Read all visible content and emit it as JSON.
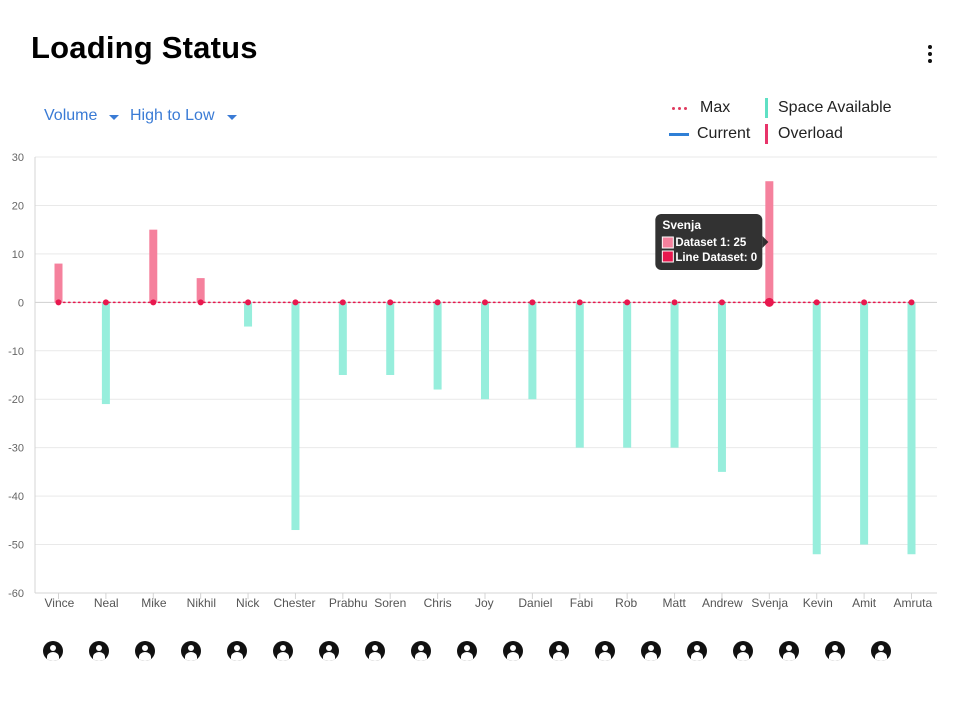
{
  "title": "Loading Status",
  "controls": {
    "volume_label": "Volume",
    "sort_label": "High to Low"
  },
  "legend": {
    "max": "Max",
    "current": "Current",
    "space_available": "Space Available",
    "overload": "Overload"
  },
  "colors": {
    "overload": "#f5819d",
    "space": "#97eedc",
    "line": "#e8184e",
    "link": "#3a7bd5"
  },
  "icons": {
    "menu": "more-vert-icon",
    "avatar": "account-circle-icon"
  },
  "tooltip": {
    "title": "Svenja",
    "line1": "Dataset 1: 25",
    "line2": "Line Dataset: 0"
  },
  "chart_data": {
    "type": "bar",
    "categories": [
      "Vince",
      "Neal",
      "Mike",
      "Nikhil",
      "Nick",
      "Chester",
      "Prabhu",
      "Soren",
      "Chris",
      "Joy",
      "Daniel",
      "Fabi",
      "Rob",
      "Matt",
      "Andrew",
      "Svenja",
      "Kevin",
      "Amit",
      "Amruta"
    ],
    "series": [
      {
        "name": "Dataset 1",
        "values": [
          8,
          -21,
          15,
          5,
          -5,
          -47,
          -15,
          -15,
          -18,
          -20,
          -20,
          -30,
          -30,
          -30,
          -35,
          25,
          -52,
          -50,
          -52
        ]
      },
      {
        "name": "Line Dataset",
        "values": [
          0,
          0,
          0,
          0,
          0,
          0,
          0,
          0,
          0,
          0,
          0,
          0,
          0,
          0,
          0,
          0,
          0,
          0,
          0
        ]
      }
    ],
    "ylim": [
      -60,
      30
    ],
    "yticks": [
      "30",
      "20",
      "10",
      "0",
      "-10",
      "-20",
      "-30",
      "-40",
      "-50",
      "-60"
    ],
    "grid": true,
    "legend_position": "top-right"
  }
}
